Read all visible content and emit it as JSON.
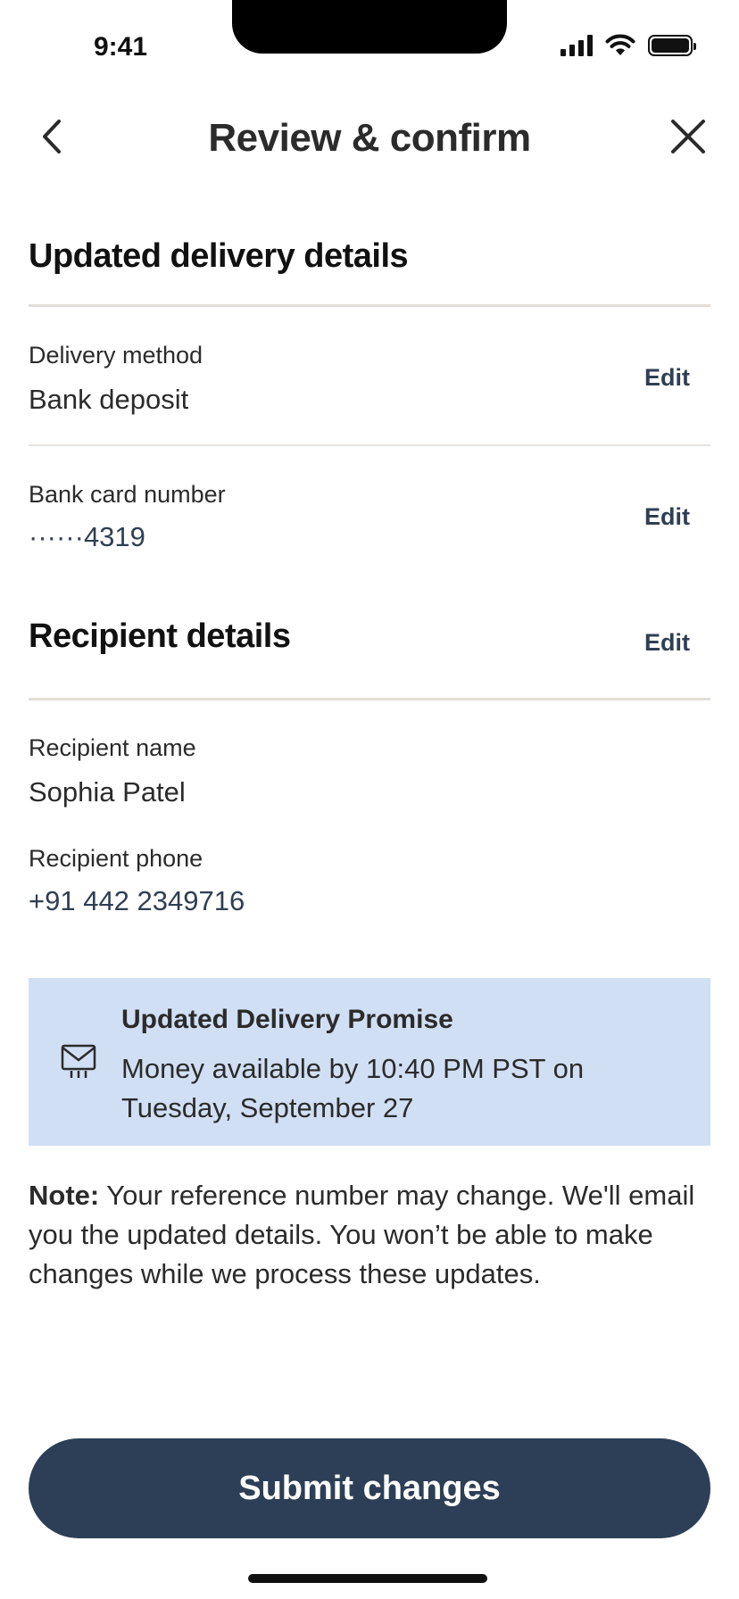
{
  "status_bar": {
    "time": "9:41"
  },
  "header": {
    "title": "Review & confirm"
  },
  "delivery_section": {
    "title": "Updated delivery details",
    "method": {
      "label": "Delivery method",
      "value": "Bank deposit",
      "edit": "Edit"
    },
    "card": {
      "label": "Bank card number",
      "value": "······4319",
      "edit": "Edit"
    }
  },
  "recipient_section": {
    "title": "Recipient details",
    "edit": "Edit",
    "name": {
      "label": "Recipient name",
      "value": "Sophia Patel"
    },
    "phone": {
      "label": "Recipient phone",
      "value": "+91 442 2349716"
    }
  },
  "promise": {
    "title": "Updated Delivery Promise",
    "text": "Money available by 10:40 PM PST on Tuesday, September 27"
  },
  "note": {
    "label": "Note:",
    "text": " Your reference number may change. We'll email you the updated details. You won’t be able to make changes while we process these updates."
  },
  "submit": {
    "label": "Submit changes"
  },
  "colors": {
    "primary": "#2d3f56",
    "promise_bg": "#d0dff4",
    "divider": "#e3ded9"
  },
  "icons": [
    "back-chevron-icon",
    "close-icon",
    "envelope-icon",
    "signal-icon",
    "wifi-icon",
    "battery-icon"
  ]
}
